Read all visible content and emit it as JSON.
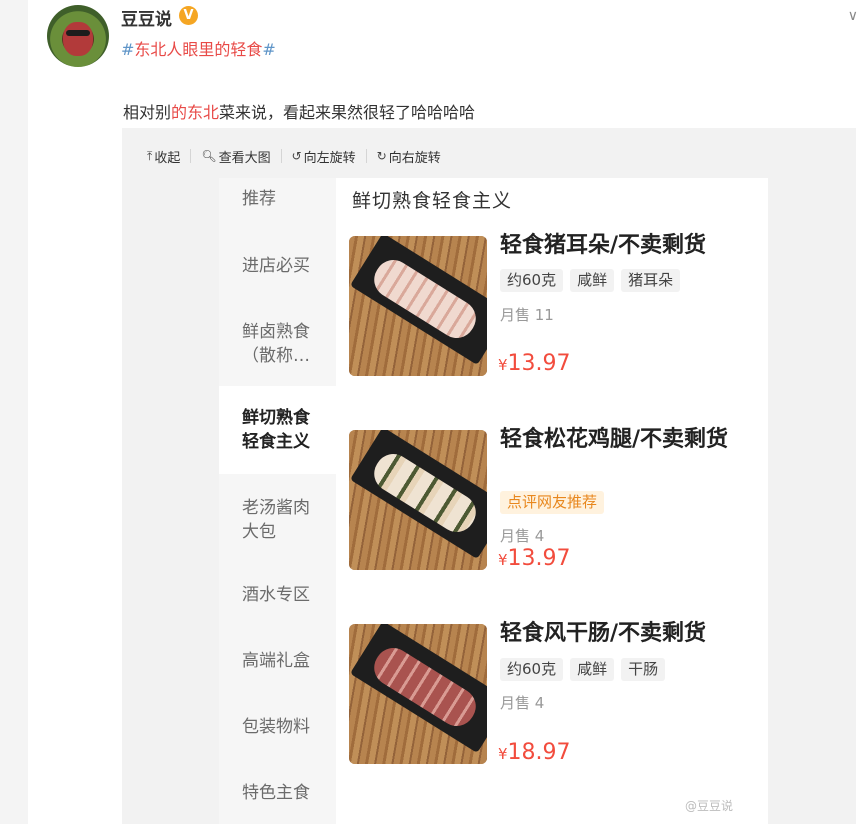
{
  "post": {
    "username": "豆豆说",
    "verified_badge": "V",
    "menu_icon": "chevron-down-icon",
    "topic_hash_open": "#",
    "topic_text": "东北人眼里的轻食",
    "topic_hash_close": "#",
    "text_before": "相对别",
    "text_highlight": "的东北",
    "text_after": "菜来说，看起来果然很轻了哈哈哈哈"
  },
  "toolbar": {
    "collapse": "收起",
    "view_large": "查看大图",
    "rotate_left": "向左旋转",
    "rotate_right": "向右旋转"
  },
  "shot": {
    "sidebar": [
      {
        "label": "推荐"
      },
      {
        "label": "进店必买"
      },
      {
        "label": "鲜卤熟食\n（散称…"
      },
      {
        "label": "鲜切熟食\n轻食主义",
        "active": true
      },
      {
        "label": "老汤酱肉\n大包"
      },
      {
        "label": "酒水专区"
      },
      {
        "label": "高端礼盒"
      },
      {
        "label": "包装物料"
      },
      {
        "label": "特色主食"
      }
    ],
    "category_title": "鲜切熟食轻食主义",
    "products": [
      {
        "name": "轻食猪耳朵/不卖剩货",
        "tags": [
          "约60克",
          "咸鲜",
          "猪耳朵"
        ],
        "sold": "月售 11",
        "price_symbol": "¥",
        "price": "13.97"
      },
      {
        "name": "轻食松花鸡腿/不卖剩货",
        "tags": [
          "点评网友推荐"
        ],
        "sold": "月售 4",
        "price_symbol": "¥",
        "price": "13.97"
      },
      {
        "name": "轻食风干肠/不卖剩货",
        "tags": [
          "约60克",
          "咸鲜",
          "干肠"
        ],
        "sold": "月售 4",
        "price_symbol": "¥",
        "price": "18.97"
      }
    ],
    "watermark": "@豆豆说"
  },
  "colors": {
    "accent": "#e84a47",
    "hashtag": "#5f95c8",
    "price": "#f24c3d",
    "recommend_tag": "#e8871d"
  }
}
